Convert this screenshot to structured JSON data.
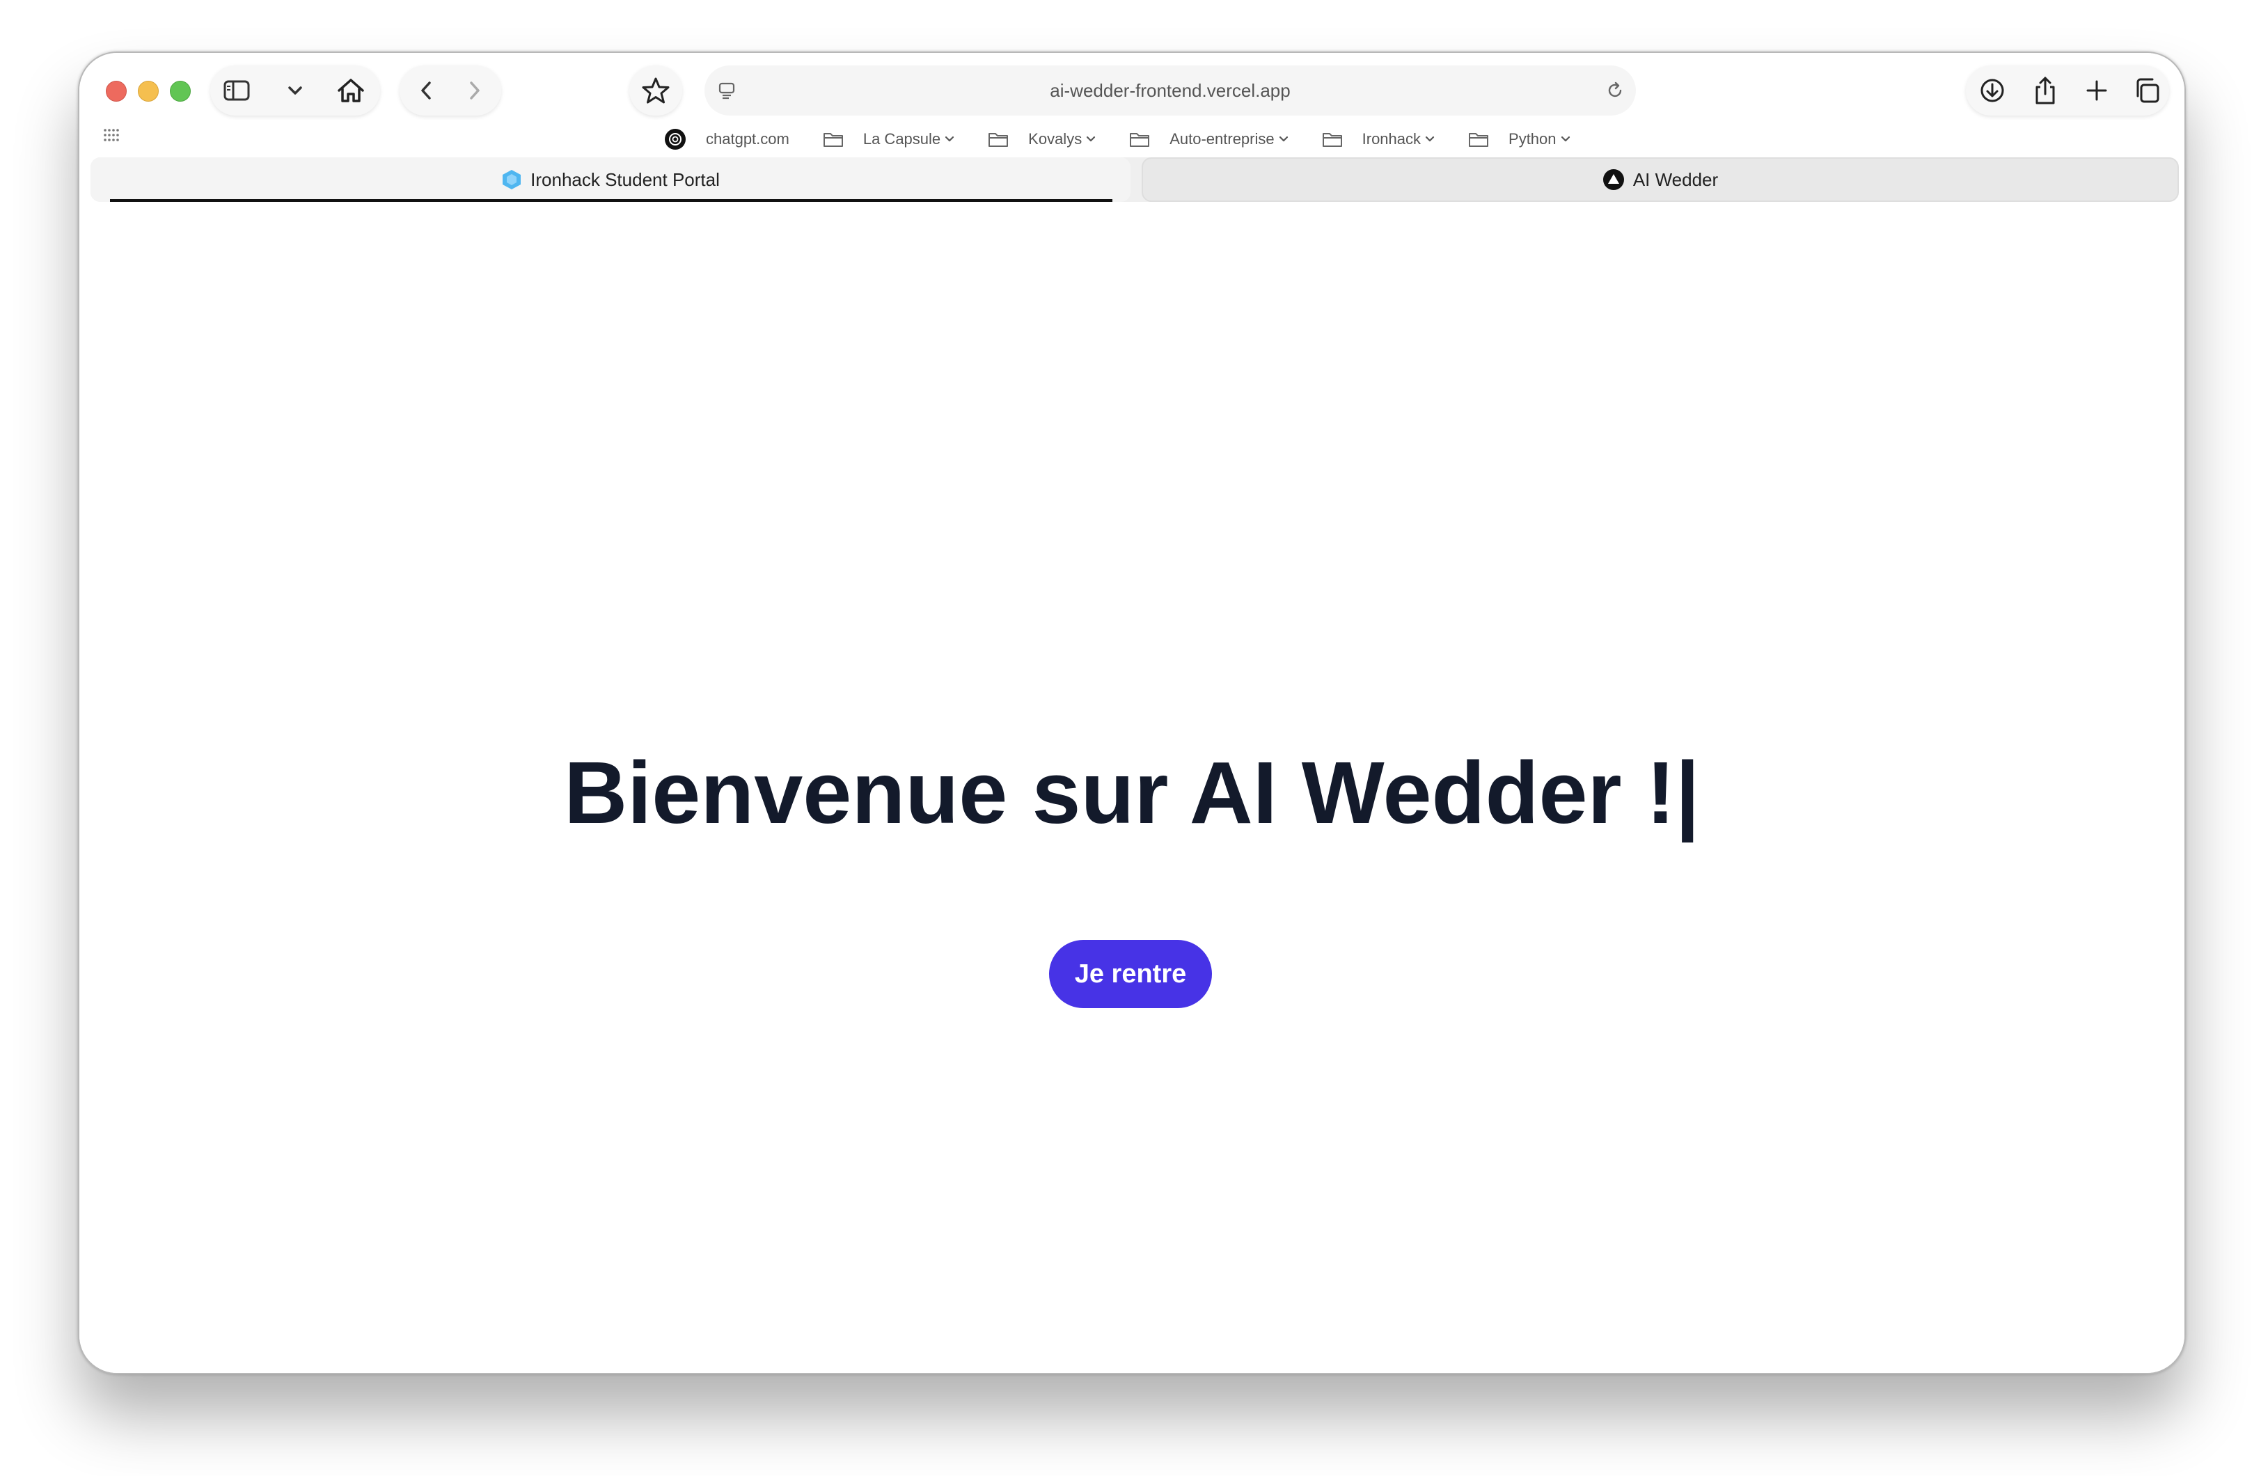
{
  "browser": {
    "address_url": "ai-wedder-frontend.vercel.app",
    "bookmarks": [
      {
        "label": "chatgpt.com",
        "icon": "chatgpt-icon",
        "dropdown": false
      },
      {
        "label": "La Capsule",
        "icon": "folder-icon",
        "dropdown": true
      },
      {
        "label": "Kovalys",
        "icon": "folder-icon",
        "dropdown": true
      },
      {
        "label": "Auto-entreprise",
        "icon": "folder-icon",
        "dropdown": true
      },
      {
        "label": "Ironhack",
        "icon": "folder-icon",
        "dropdown": true
      },
      {
        "label": "Python",
        "icon": "folder-icon",
        "dropdown": true
      }
    ],
    "tabs": [
      {
        "label": "Ironhack Student Portal",
        "icon": "ironhack-favicon",
        "active": true
      },
      {
        "label": "AI Wedder",
        "icon": "vercel-favicon",
        "active": false
      }
    ]
  },
  "page": {
    "title": "Bienvenue sur AI Wedder !|",
    "cta_label": "Je rentre",
    "accent_color": "#4733e6",
    "title_color": "#131a2b"
  }
}
